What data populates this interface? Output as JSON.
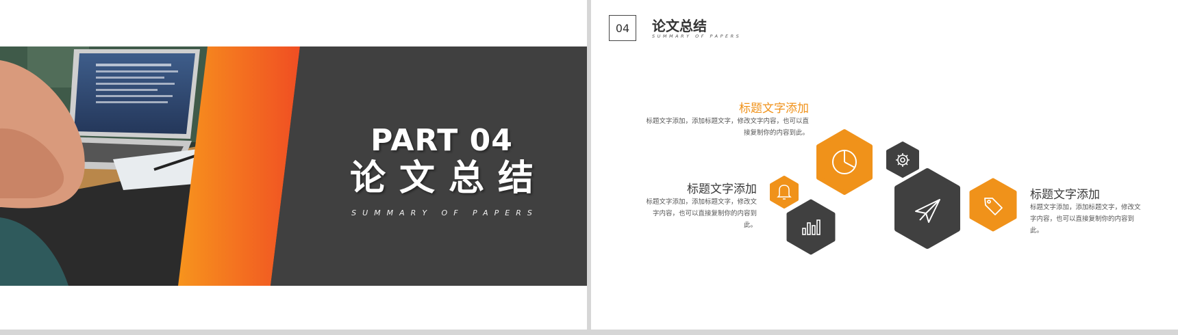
{
  "left_slide": {
    "title_en": "PART 04",
    "title_cn": "论文总结",
    "subtitle": "SUMMARY OF PAPERS"
  },
  "right_slide": {
    "section_number": "04",
    "header_title": "论文总结",
    "header_subtitle": "SUMMARY OF PAPERS",
    "blocks": [
      {
        "title": "标题文字添加",
        "text": "标题文字添加，添加标题文字，修改文字内容，也可以直接复制你的内容到此。"
      },
      {
        "title": "标题文字添加",
        "text": "标题文字添加，添加标题文字，修改文字内容，也可以直接复制你的内容到此。"
      },
      {
        "title": "标题文字添加",
        "text": "标题文字添加，添加标题文字，修改文字内容，也可以直接复制你的内容到此。"
      }
    ]
  },
  "colors": {
    "accent_orange": "#f0921a",
    "dark_gray": "#404040",
    "gradient_orange_start": "#f7941d",
    "gradient_orange_end": "#f04e23"
  },
  "icons": [
    "pie-chart-icon",
    "gear-icon",
    "bell-icon",
    "bar-chart-icon",
    "paper-plane-icon",
    "tag-icon"
  ]
}
